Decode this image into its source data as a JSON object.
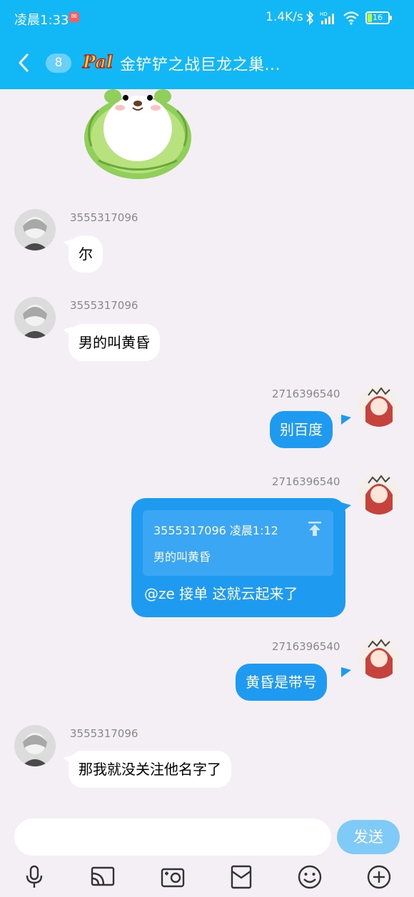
{
  "status_bar": {
    "time": "凌晨1:33",
    "app_badge": "✉",
    "net_speed": "1.4K/s",
    "battery": "16"
  },
  "header": {
    "unread_count": "8",
    "group_title": "金铲铲之战巨龙之巢..."
  },
  "messages": [
    {
      "sender": "3555317096",
      "text": "尔",
      "direction": "in"
    },
    {
      "sender": "3555317096",
      "text": "男的叫黄昏",
      "direction": "in"
    },
    {
      "sender": "2716396540",
      "text": "别百度",
      "direction": "out"
    },
    {
      "sender": "2716396540",
      "direction": "out",
      "quote": {
        "header": "3555317096 凌晨1:12",
        "text": "男的叫黄昏"
      },
      "text": "@ze 接单 这就云起来了"
    },
    {
      "sender": "2716396540",
      "text": "黄昏是带号",
      "direction": "out"
    },
    {
      "sender": "3555317096",
      "text": "那我就没关注他名字了",
      "direction": "in"
    }
  ],
  "input": {
    "value": "",
    "send_label": "发送"
  },
  "toolbar": {
    "icons": [
      "microphone-icon",
      "screen-cast-icon",
      "photo-icon",
      "red-envelope-icon",
      "emoji-icon",
      "plus-icon"
    ]
  },
  "colors": {
    "header": "#12b7f5",
    "bubble_out": "#1e9bf0",
    "bubble_in": "#ffffff",
    "background": "#f3eff5"
  }
}
